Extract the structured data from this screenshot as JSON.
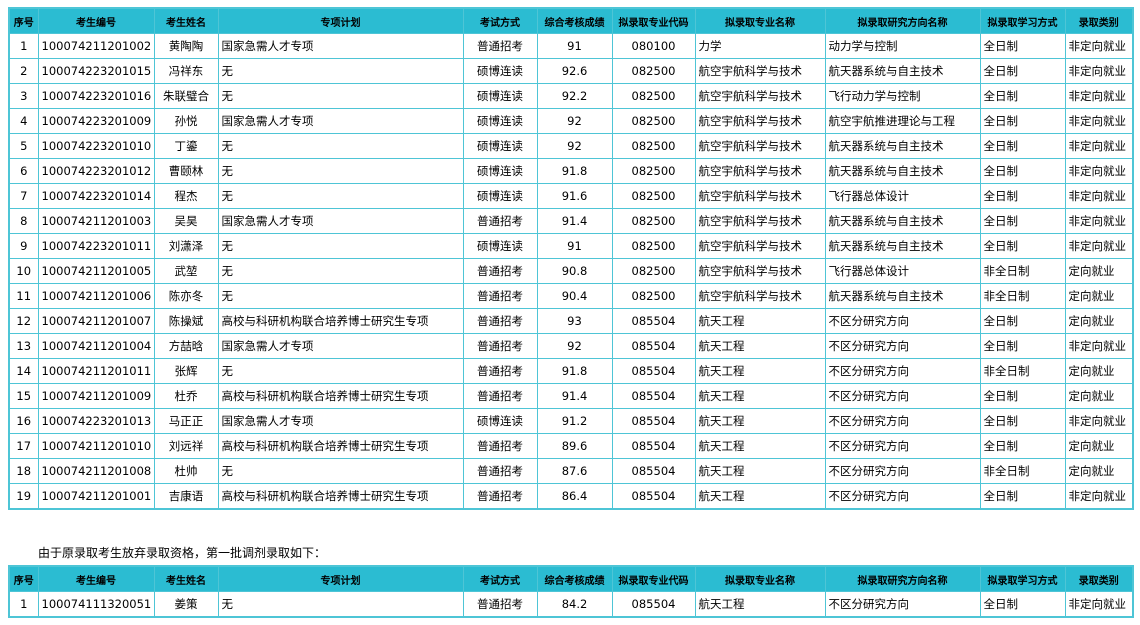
{
  "headers": [
    "序号",
    "考生编号",
    "考生姓名",
    "专项计划",
    "考试方式",
    "综合考核成绩",
    "拟录取专业代码",
    "拟录取专业名称",
    "拟录取研究方向名称",
    "拟录取学习方式",
    "录取类别"
  ],
  "rows": [
    [
      "1",
      "100074211201002",
      "黄陶陶",
      "国家急需人才专项",
      "普通招考",
      "91",
      "080100",
      "力学",
      "动力学与控制",
      "全日制",
      "非定向就业"
    ],
    [
      "2",
      "100074223201015",
      "冯祥东",
      "无",
      "硕博连读",
      "92.6",
      "082500",
      "航空宇航科学与技术",
      "航天器系统与自主技术",
      "全日制",
      "非定向就业"
    ],
    [
      "3",
      "100074223201016",
      "朱联璧合",
      "无",
      "硕博连读",
      "92.2",
      "082500",
      "航空宇航科学与技术",
      "飞行动力学与控制",
      "全日制",
      "非定向就业"
    ],
    [
      "4",
      "100074223201009",
      "孙悦",
      "国家急需人才专项",
      "硕博连读",
      "92",
      "082500",
      "航空宇航科学与技术",
      "航空宇航推进理论与工程",
      "全日制",
      "非定向就业"
    ],
    [
      "5",
      "100074223201010",
      "丁鎏",
      "无",
      "硕博连读",
      "92",
      "082500",
      "航空宇航科学与技术",
      "航天器系统与自主技术",
      "全日制",
      "非定向就业"
    ],
    [
      "6",
      "100074223201012",
      "曹颐林",
      "无",
      "硕博连读",
      "91.8",
      "082500",
      "航空宇航科学与技术",
      "航天器系统与自主技术",
      "全日制",
      "非定向就业"
    ],
    [
      "7",
      "100074223201014",
      "程杰",
      "无",
      "硕博连读",
      "91.6",
      "082500",
      "航空宇航科学与技术",
      "飞行器总体设计",
      "全日制",
      "非定向就业"
    ],
    [
      "8",
      "100074211201003",
      "吴昊",
      "国家急需人才专项",
      "普通招考",
      "91.4",
      "082500",
      "航空宇航科学与技术",
      "航天器系统与自主技术",
      "全日制",
      "非定向就业"
    ],
    [
      "9",
      "100074223201011",
      "刘潇泽",
      "无",
      "硕博连读",
      "91",
      "082500",
      "航空宇航科学与技术",
      "航天器系统与自主技术",
      "全日制",
      "非定向就业"
    ],
    [
      "10",
      "100074211201005",
      "武堃",
      "无",
      "普通招考",
      "90.8",
      "082500",
      "航空宇航科学与技术",
      "飞行器总体设计",
      "非全日制",
      "定向就业"
    ],
    [
      "11",
      "100074211201006",
      "陈亦冬",
      "无",
      "普通招考",
      "90.4",
      "082500",
      "航空宇航科学与技术",
      "航天器系统与自主技术",
      "非全日制",
      "定向就业"
    ],
    [
      "12",
      "100074211201007",
      "陈操斌",
      "高校与科研机构联合培养博士研究生专项",
      "普通招考",
      "93",
      "085504",
      "航天工程",
      "不区分研究方向",
      "全日制",
      "定向就业"
    ],
    [
      "13",
      "100074211201004",
      "方喆晗",
      "国家急需人才专项",
      "普通招考",
      "92",
      "085504",
      "航天工程",
      "不区分研究方向",
      "全日制",
      "非定向就业"
    ],
    [
      "14",
      "100074211201011",
      "张辉",
      "无",
      "普通招考",
      "91.8",
      "085504",
      "航天工程",
      "不区分研究方向",
      "非全日制",
      "定向就业"
    ],
    [
      "15",
      "100074211201009",
      "杜乔",
      "高校与科研机构联合培养博士研究生专项",
      "普通招考",
      "91.4",
      "085504",
      "航天工程",
      "不区分研究方向",
      "全日制",
      "定向就业"
    ],
    [
      "16",
      "100074223201013",
      "马正正",
      "国家急需人才专项",
      "硕博连读",
      "91.2",
      "085504",
      "航天工程",
      "不区分研究方向",
      "全日制",
      "非定向就业"
    ],
    [
      "17",
      "100074211201010",
      "刘远祥",
      "高校与科研机构联合培养博士研究生专项",
      "普通招考",
      "89.6",
      "085504",
      "航天工程",
      "不区分研究方向",
      "全日制",
      "定向就业"
    ],
    [
      "18",
      "100074211201008",
      "杜帅",
      "无",
      "普通招考",
      "87.6",
      "085504",
      "航天工程",
      "不区分研究方向",
      "非全日制",
      "定向就业"
    ],
    [
      "19",
      "100074211201001",
      "吉康语",
      "高校与科研机构联合培养博士研究生专项",
      "普通招考",
      "86.4",
      "085504",
      "航天工程",
      "不区分研究方向",
      "全日制",
      "非定向就业"
    ]
  ],
  "note": "由于原录取考生放弃录取资格，第一批调剂录取如下：",
  "rows2": [
    [
      "1",
      "100074111320051",
      "姜策",
      "无",
      "普通招考",
      "84.2",
      "085504",
      "航天工程",
      "不区分研究方向",
      "全日制",
      "非定向就业"
    ]
  ]
}
